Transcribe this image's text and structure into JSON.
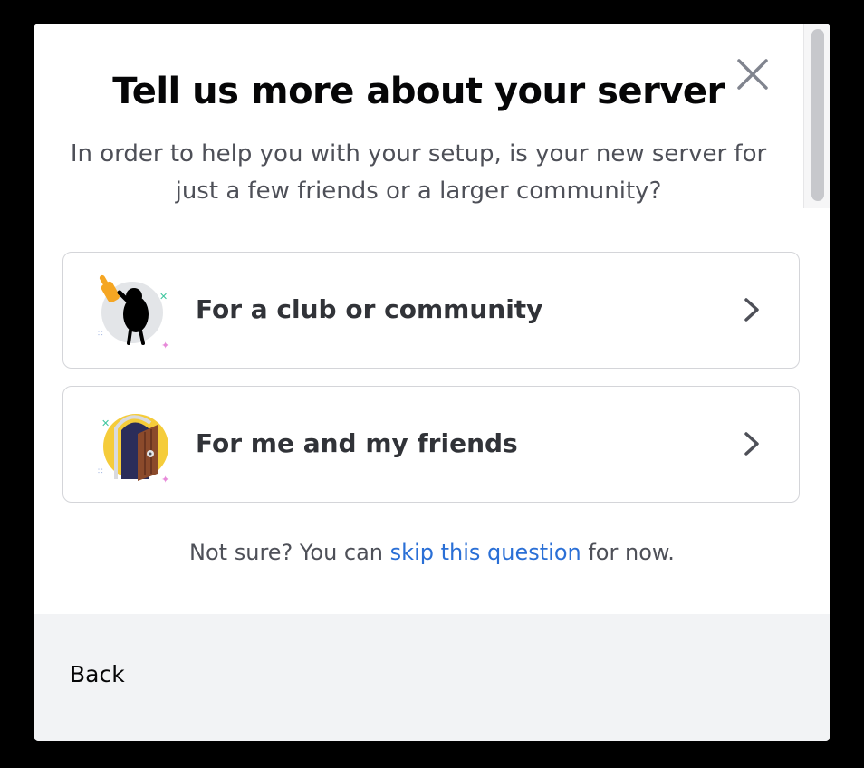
{
  "dialog": {
    "title": "Tell us more about your server",
    "subtitle": "In order to help you with your setup, is your new server for just a few friends or a larger community?",
    "close_icon": "close-icon"
  },
  "options": [
    {
      "label": "For a club or community",
      "icon": "club-community-illustration-icon",
      "chevron_icon": "chevron-right-icon"
    },
    {
      "label": "For me and my friends",
      "icon": "friends-door-illustration-icon",
      "chevron_icon": "chevron-right-icon"
    }
  ],
  "skip": {
    "prefix": "Not sure? You can",
    "link": "skip this question",
    "suffix": "for now."
  },
  "footer": {
    "back_label": "Back"
  },
  "colors": {
    "link": "#2a6fd6",
    "title": "#060607",
    "body_text": "#4e5058",
    "footer_bg": "#f2f3f5",
    "accent_orange": "#f5a623",
    "accent_yellow": "#f5cc3a"
  }
}
